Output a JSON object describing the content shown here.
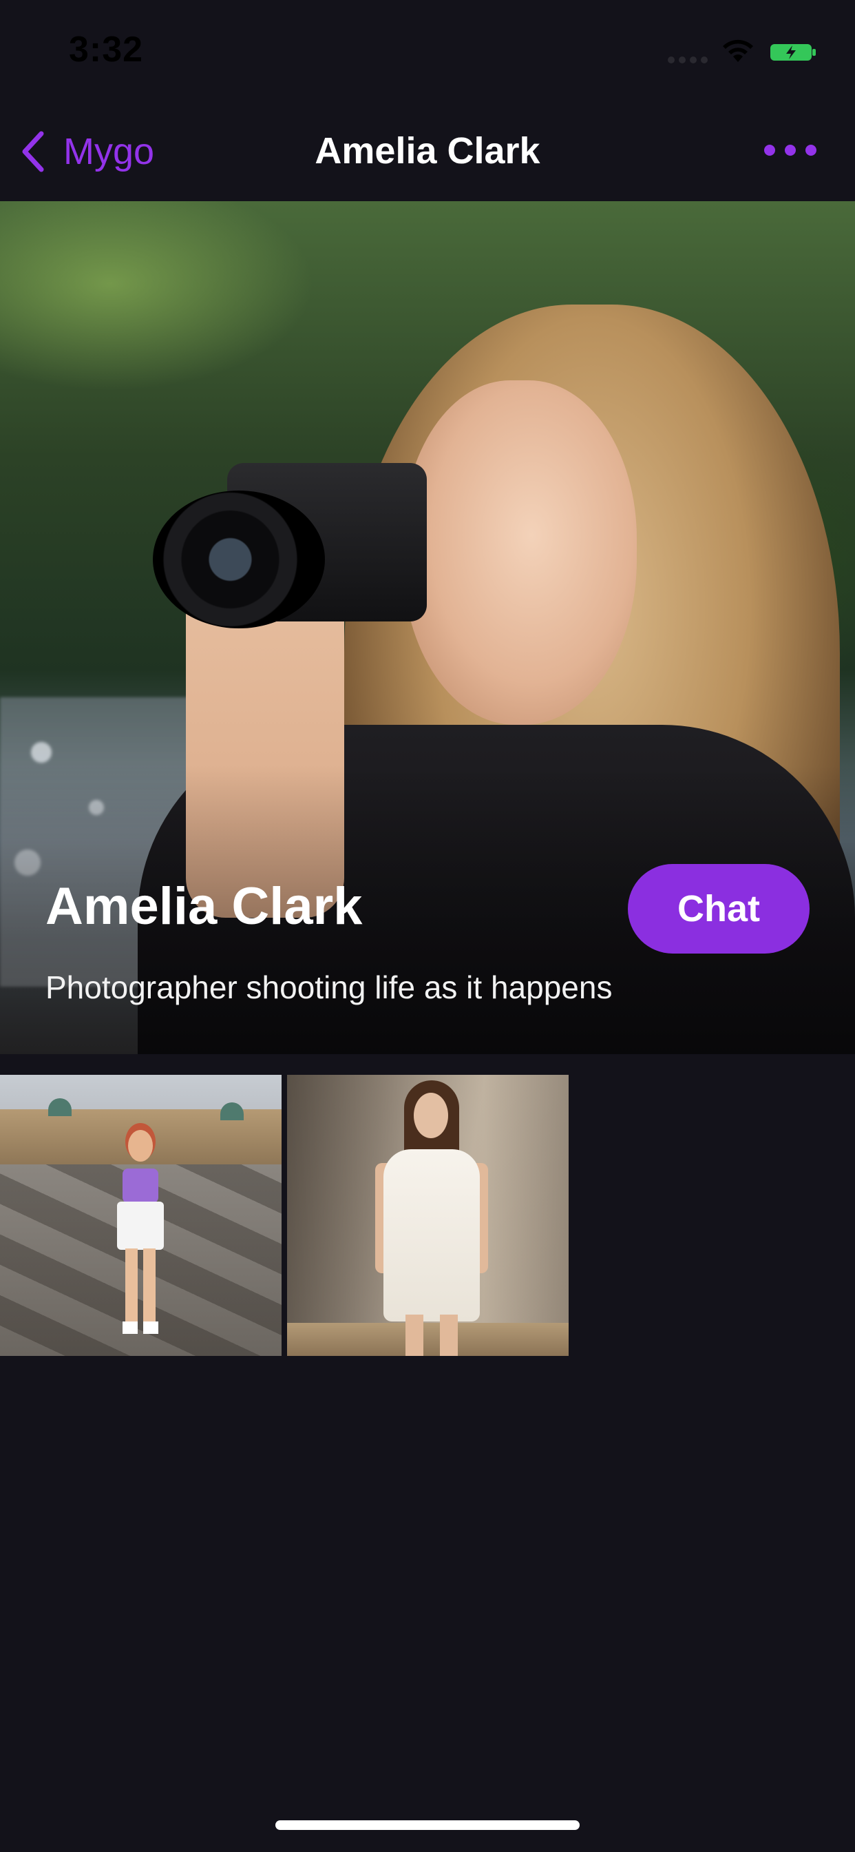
{
  "status_bar": {
    "time": "3:32",
    "icons": [
      "signal-icon",
      "wifi-icon",
      "battery-charging-icon"
    ],
    "battery_color": "#34c759"
  },
  "nav": {
    "back_label": "Mygo",
    "title": "Amelia Clark",
    "back_icon": "chevron-left-icon",
    "more_icon": "more-horizontal-icon",
    "accent_color": "#9333ea"
  },
  "profile": {
    "name": "Amelia Clark",
    "tagline": "Photographer shooting life as it happens",
    "chat_label": "Chat",
    "chat_color": "#8b2fe0"
  },
  "gallery": {
    "items": [
      {
        "scene": "plaza"
      },
      {
        "scene": "white-dress"
      }
    ]
  },
  "theme": {
    "background": "#13121a"
  }
}
